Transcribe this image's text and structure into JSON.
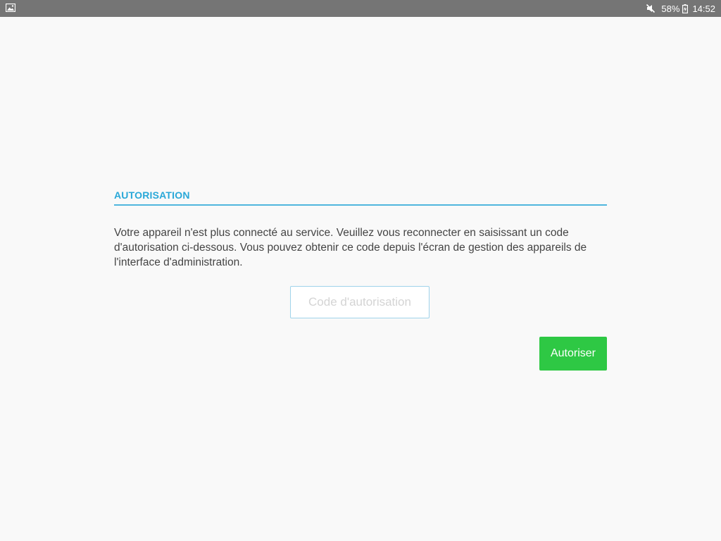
{
  "status_bar": {
    "left_icon": "image-notification-icon",
    "mute_icon": "mute-icon",
    "battery_percent": "58%",
    "battery_icon": "battery-charging-icon",
    "time": "14:52",
    "background_color": "#757575"
  },
  "authorization": {
    "title": "AUTORISATION",
    "title_color": "#29a8d8",
    "message": "Votre appareil n'est plus connecté au service. Veuillez vous reconnecter en saisissant un code d'autorisation ci-dessous. Vous pouvez obtenir ce code depuis l'écran de gestion des appareils de l'interface d'administration.",
    "code_field": {
      "placeholder": "Code d'autorisation",
      "value": ""
    },
    "authorize_button": {
      "label": "Autoriser",
      "color": "#2ec844"
    }
  }
}
